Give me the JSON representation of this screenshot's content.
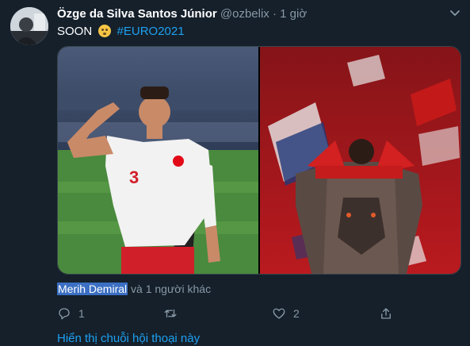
{
  "author": {
    "display_name": "Özge da Silva Santos Júnior",
    "handle": "@ozbelix",
    "separator": "·",
    "time": "1 giờ"
  },
  "tweet": {
    "text": "SOON",
    "emoji": "hushed-face-emoji",
    "hashtag": "#EURO2021"
  },
  "media": {
    "left_photo": "footballer-saluting-photo",
    "right_photo": "player-lion-tattoo-photo"
  },
  "tagged": {
    "name": "Merih Demiral",
    "rest": "và 1 người khác"
  },
  "actions": {
    "reply_count": "1",
    "like_count": "2"
  },
  "thread_link": "Hiển thị chuỗi hội thoại này",
  "colors": {
    "background": "#15202b",
    "accent": "#1da1f2",
    "muted": "#8899a6",
    "highlight": "#3b6fc3"
  }
}
